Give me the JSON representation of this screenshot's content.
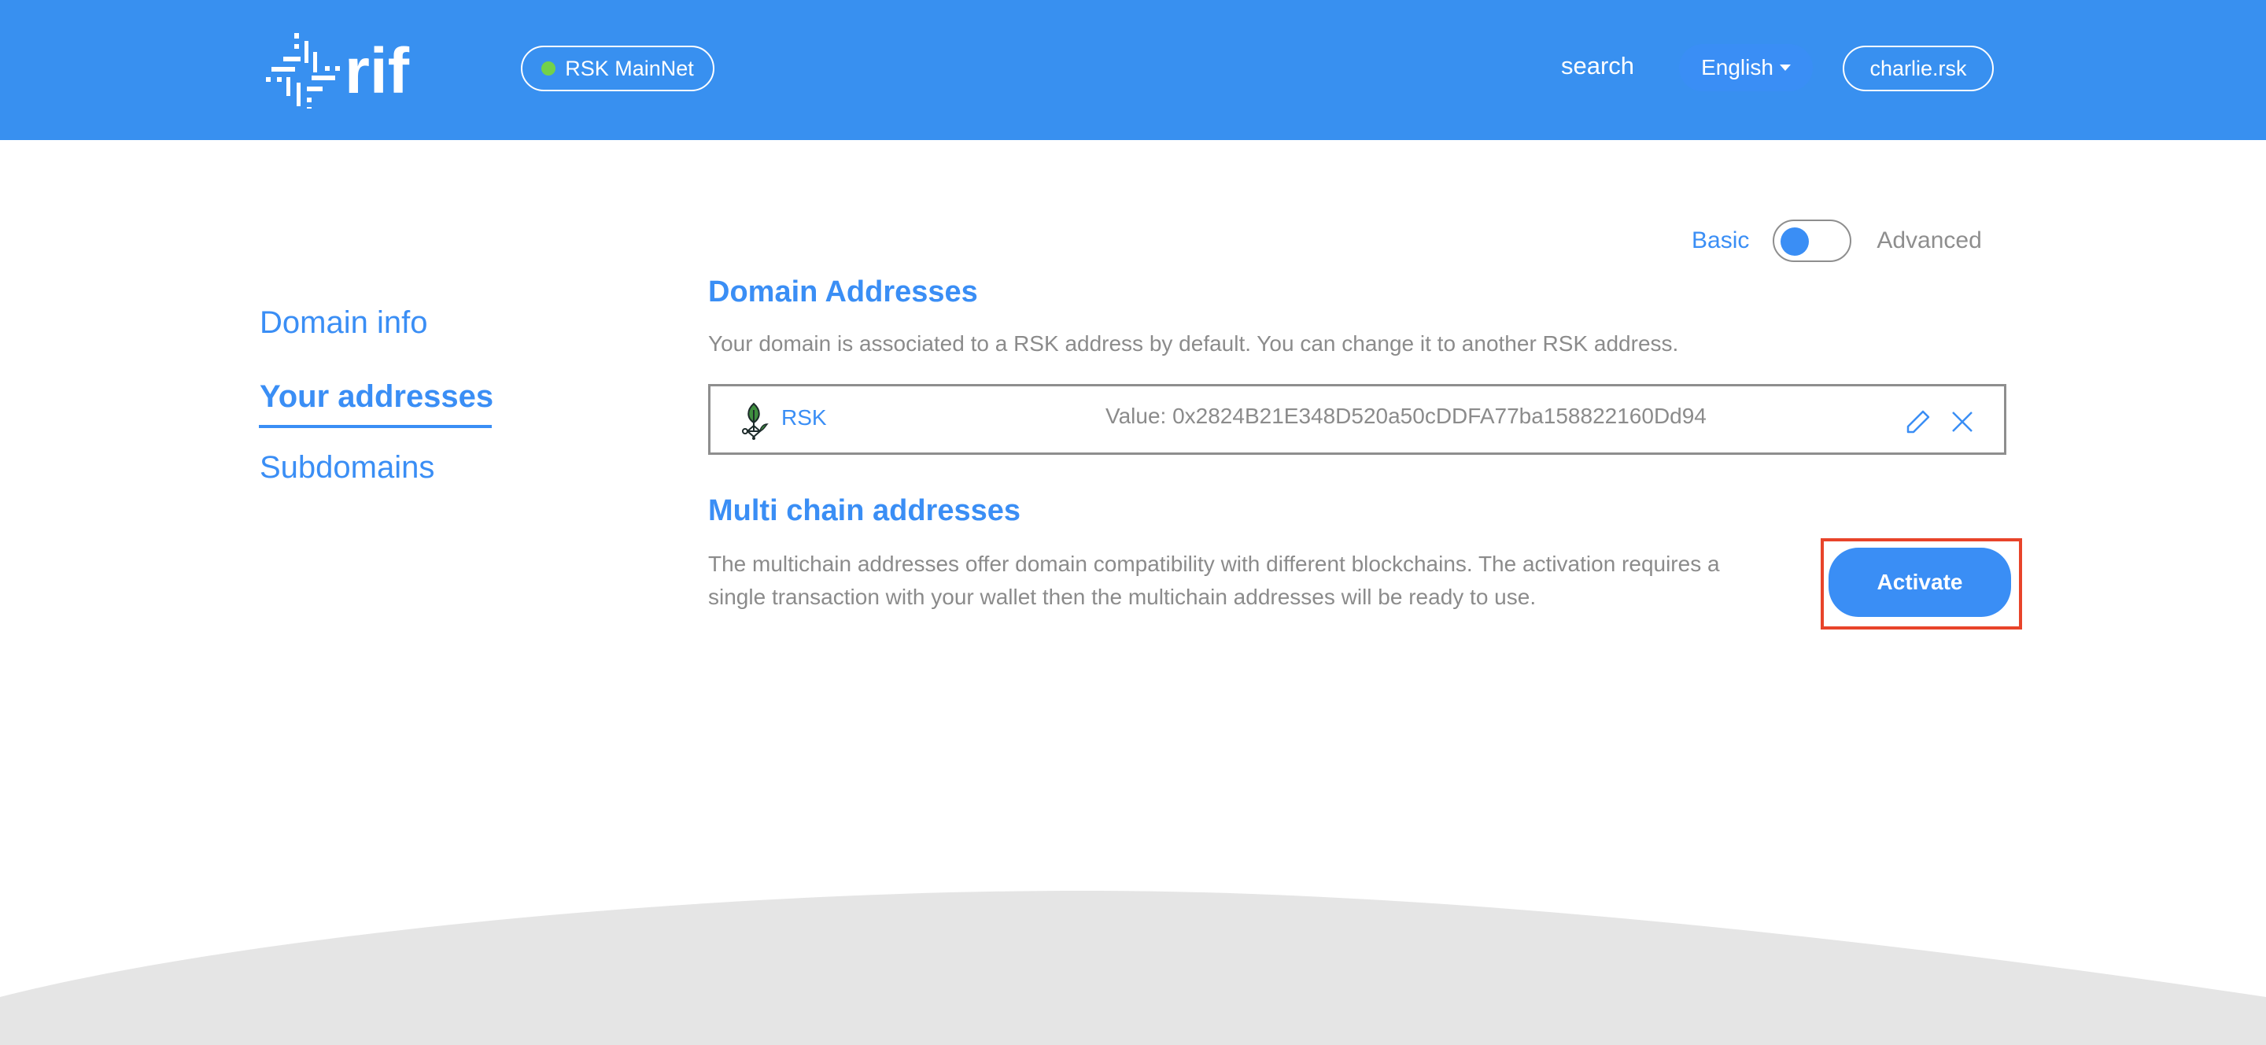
{
  "header": {
    "logo_text": "rif",
    "network": {
      "label": "RSK MainNet",
      "status_color": "#72d14a"
    },
    "search_label": "search",
    "language": {
      "selected": "English"
    },
    "account_label": "charlie.rsk",
    "background_color": "#3890f0"
  },
  "mode_toggle": {
    "left_label": "Basic",
    "right_label": "Advanced",
    "selected": "Basic"
  },
  "sidebar": {
    "items": [
      {
        "label": "Domain info",
        "active": false
      },
      {
        "label": "Your addresses",
        "active": true
      },
      {
        "label": "Subdomains",
        "active": false
      }
    ]
  },
  "domain_addresses": {
    "title": "Domain Addresses",
    "description": "Your domain is associated to a RSK address by default. You can change it to another RSK address.",
    "rows": [
      {
        "chain": "RSK",
        "value_prefix": "Value: ",
        "value": "0x2824B21E348D520a50cDDFA77ba158822160Dd94",
        "display": "Value: 0x2824B21E348D520a50cDDFA77ba158822160Dd94"
      }
    ]
  },
  "multichain": {
    "title": "Multi chain addresses",
    "description": "The multichain addresses offer domain compatibility with different blockchains. The activation requires a single transaction with your wallet then the multichain addresses will be ready to use.",
    "activate_label": "Activate"
  },
  "colors": {
    "accent": "#3a8ef5",
    "muted_text": "#8b8b8b",
    "highlight": "#e8442a",
    "footer": "#e5e5e5"
  }
}
